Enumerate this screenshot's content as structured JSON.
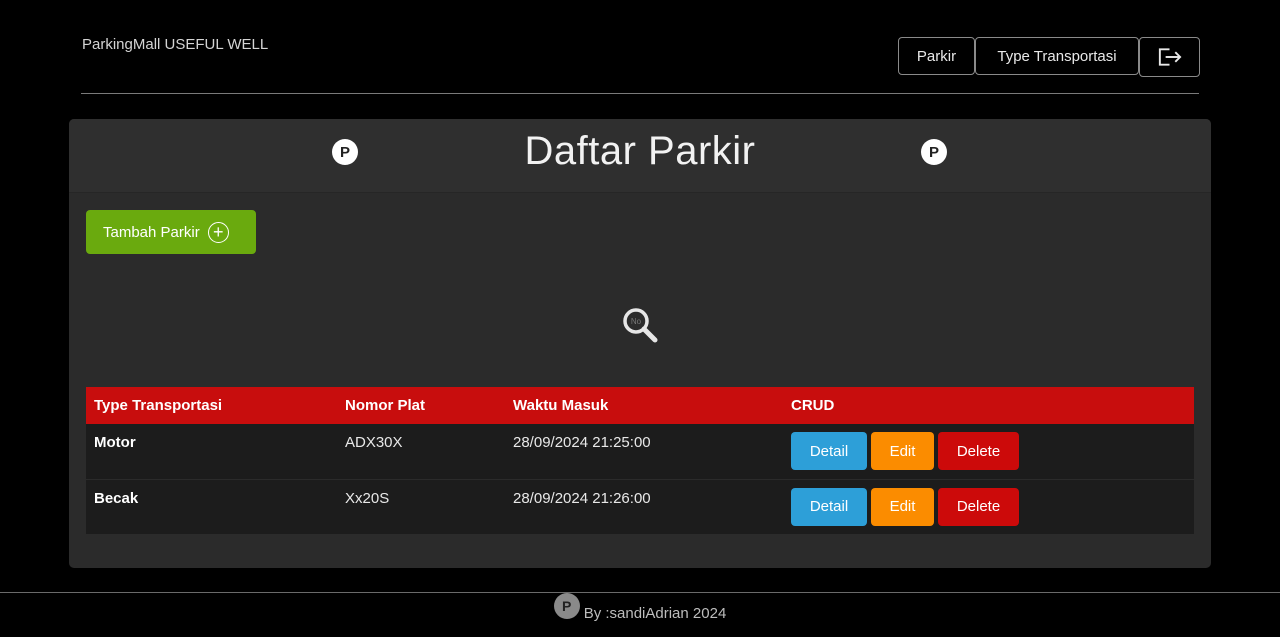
{
  "brand": "ParkingMall USEFUL WELL",
  "nav": {
    "parkir_label": "Parkir",
    "type_label": "Type Transportasi",
    "logout_icon": "logout-icon"
  },
  "card": {
    "title": "Daftar Parkir",
    "badge_letter": "P",
    "add_button_label": "Tambah Parkir",
    "add_icon": "plus-circle-icon",
    "search_icon": "search-icon",
    "search_icon_text": "No"
  },
  "table": {
    "headers": [
      "Type Transportasi",
      "Nomor Plat",
      "Waktu Masuk",
      "CRUD"
    ],
    "rows": [
      {
        "type": "Motor",
        "plate": "ADX30X",
        "time": "28/09/2024 21:25:00"
      },
      {
        "type": "Becak",
        "plate": "Xx20S",
        "time": "28/09/2024 21:26:00"
      }
    ],
    "actions": {
      "detail": "Detail",
      "edit": "Edit",
      "delete": "Delete"
    }
  },
  "footer": {
    "badge_letter": "P",
    "text": "By :sandiAdrian 2024"
  },
  "colors": {
    "accent_green": "#6aaa0e",
    "header_red": "#c80d0d",
    "detail_blue": "#2d9fd8",
    "edit_orange": "#fb8c00",
    "delete_red": "#cc0a0a"
  }
}
